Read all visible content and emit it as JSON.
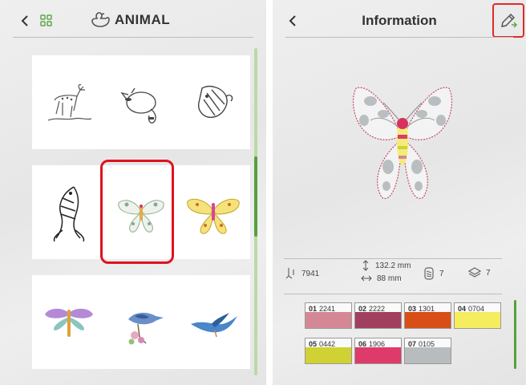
{
  "left": {
    "header": {
      "title": "ANIMAL"
    }
  },
  "right": {
    "header": {
      "title": "Information"
    },
    "stats": {
      "stitches": "7941",
      "height": "132.2 mm",
      "width": "88 mm",
      "color_changes": "7",
      "layers": "7"
    },
    "thread_colors": [
      {
        "index": "01",
        "code": "2241",
        "color": "#d48896"
      },
      {
        "index": "02",
        "code": "2222",
        "color": "#a0405e"
      },
      {
        "index": "03",
        "code": "1301",
        "color": "#d84e17"
      },
      {
        "index": "04",
        "code": "0704",
        "color": "#f5ec5e"
      },
      {
        "index": "05",
        "code": "0442",
        "color": "#d0d132"
      },
      {
        "index": "06",
        "code": "1906",
        "color": "#de3a6a"
      },
      {
        "index": "07",
        "code": "0105",
        "color": "#b7bcbf"
      }
    ]
  },
  "theme": {
    "accent": "#56a03c",
    "highlight": "#e0121f"
  },
  "icons": [
    "chevron-left-icon",
    "grid-view-icon",
    "duck-icon",
    "edit-pencil-icon",
    "stitch-needle-icon",
    "height-arrow-icon",
    "width-arrow-icon",
    "thread-spool-icon",
    "layers-icon"
  ]
}
